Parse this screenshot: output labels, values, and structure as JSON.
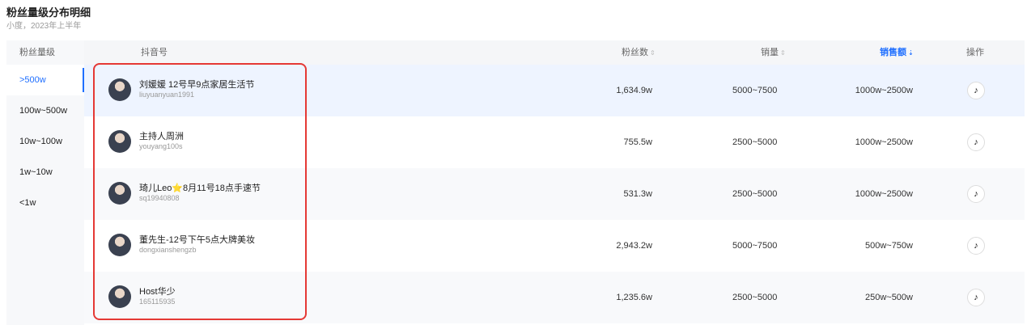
{
  "header": {
    "title": "粉丝量级分布明细",
    "subtitle": "小度，2023年上半年"
  },
  "sidebar": {
    "header": "粉丝量级",
    "items": [
      {
        "label": ">500w",
        "active": true
      },
      {
        "label": "100w~500w",
        "active": false
      },
      {
        "label": "10w~100w",
        "active": false
      },
      {
        "label": "1w~10w",
        "active": false
      },
      {
        "label": "<1w",
        "active": false
      }
    ]
  },
  "table": {
    "columns": {
      "account": "抖音号",
      "fans": "粉丝数",
      "sales_volume": "销量",
      "sales_amount": "销售额",
      "action": "操作"
    },
    "sort_icon": "⇕",
    "sort_active_icon": "⇣",
    "action_icon": "♪",
    "rows": [
      {
        "name": "刘媛媛 12号早9点家居生活节",
        "handle": "liuyuanyuan1991",
        "fans": "1,634.9w",
        "sales_volume": "5000~7500",
        "sales_amount": "1000w~2500w"
      },
      {
        "name": "主持人周洲",
        "handle": "youyang100s",
        "fans": "755.5w",
        "sales_volume": "2500~5000",
        "sales_amount": "1000w~2500w"
      },
      {
        "name": "琦儿Leo⭐8月11号18点手速节",
        "handle": "sq19940808",
        "fans": "531.3w",
        "sales_volume": "2500~5000",
        "sales_amount": "1000w~2500w"
      },
      {
        "name": "董先生-12号下午5点大牌美妆",
        "handle": "dongxianshengzb",
        "fans": "2,943.2w",
        "sales_volume": "5000~7500",
        "sales_amount": "500w~750w"
      },
      {
        "name": "Host华少",
        "handle": "165115935",
        "fans": "1,235.6w",
        "sales_volume": "2500~5000",
        "sales_amount": "250w~500w"
      }
    ]
  },
  "colors": {
    "accent": "#1f6fff",
    "highlight_box": "#e53935"
  }
}
